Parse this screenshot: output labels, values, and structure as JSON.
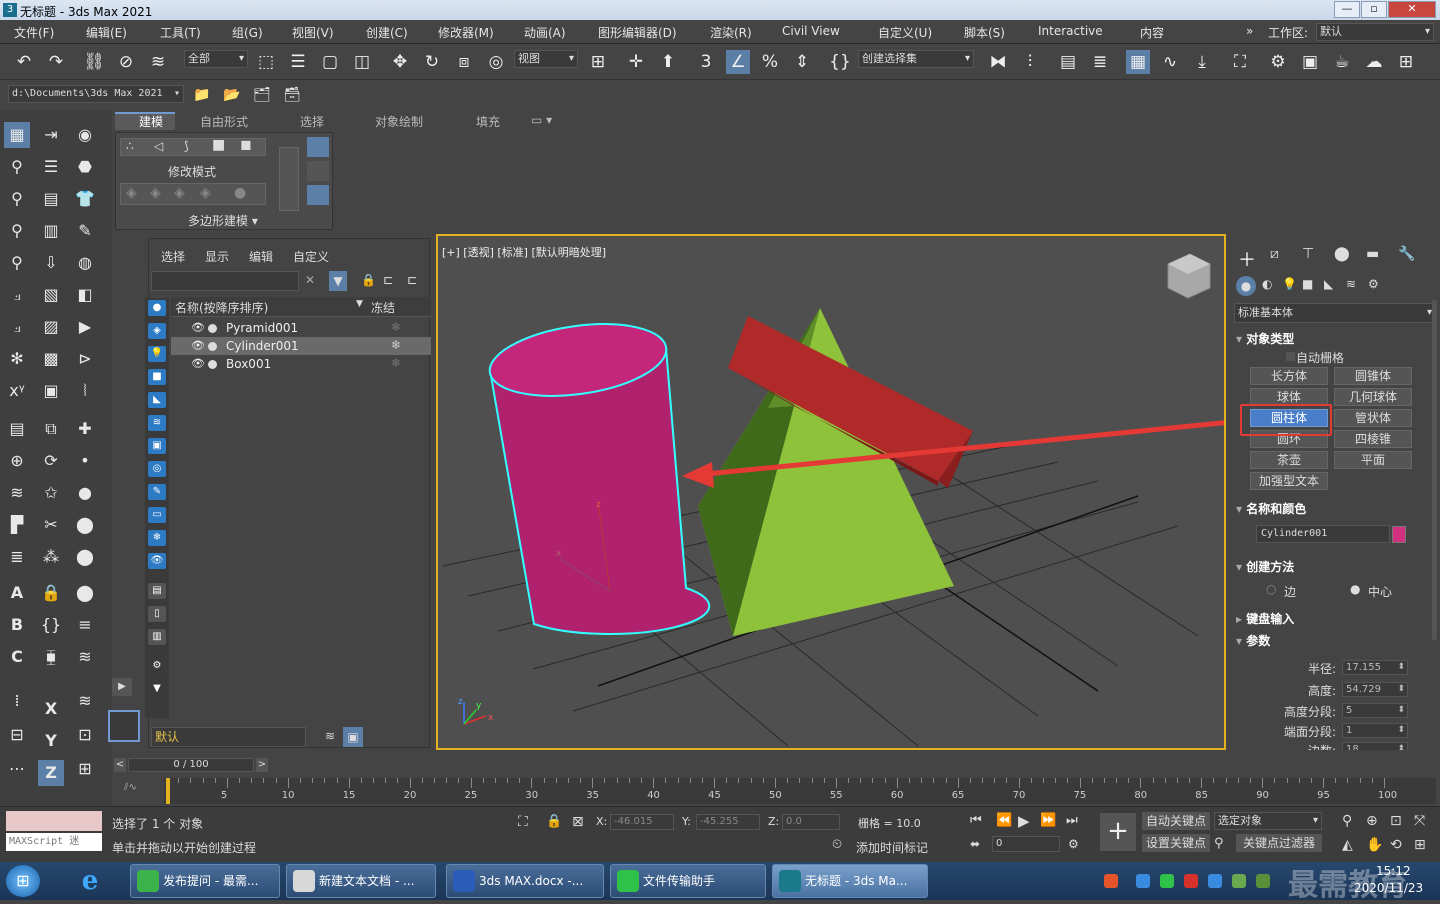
{
  "window": {
    "title": "无标题 - 3ds Max 2021",
    "logo_glyph": "3",
    "minimize": "—",
    "restore": "▫",
    "close": "✕"
  },
  "menu": [
    "文件(F)",
    "编辑(E)",
    "工具(T)",
    "组(G)",
    "视图(V)",
    "创建(C)",
    "修改器(M)",
    "动画(A)",
    "图形编辑器(D)",
    "渲染(R)",
    "Civil View",
    "自定义(U)",
    "脚本(S)",
    "Interactive",
    "内容"
  ],
  "workspace": {
    "expander": "»",
    "label": "工作区:",
    "value": "默认"
  },
  "toolbar": {
    "selection_filter": "全部",
    "ref_coord": "视图",
    "named_selection": "创建选择集"
  },
  "path": {
    "value": "d:\\Documents\\3ds Max 2021"
  },
  "ribbon": {
    "tabs": [
      "建模",
      "自由形式",
      "选择",
      "对象绘制",
      "填充"
    ],
    "modify_mode": "修改模式",
    "poly_modeling": "多边形建模 ▾",
    "tab_menu": "▭ ▾"
  },
  "scene": {
    "menus": [
      "选择",
      "显示",
      "编辑",
      "自定义"
    ],
    "search_clear": "✕",
    "col_name": "名称(按降序排序)",
    "col_freeze": "冻结",
    "rows": [
      {
        "name": "Pyramid001",
        "freeze": "❄"
      },
      {
        "name": "Cylinder001",
        "freeze": "❄"
      },
      {
        "name": "Box001",
        "freeze": "❄"
      }
    ],
    "layer": "默认"
  },
  "viewport": {
    "label": "[+] [透视] [标准] [默认明暗处理]",
    "axis_x": "x",
    "axis_y": "y",
    "axis_z": "z"
  },
  "command_panel": {
    "category": "标准基本体",
    "section_object_type": "对象类型",
    "autogrid": "自动栅格",
    "buttons": [
      "长方体",
      "圆锥体",
      "球体",
      "几何球体",
      "圆柱体",
      "管状体",
      "圆环",
      "四棱锥",
      "茶壶",
      "平面",
      "加强型文本"
    ],
    "section_name_color": "名称和颜色",
    "object_name": "Cylinder001",
    "object_color": "#d1307f",
    "section_creation": "创建方法",
    "opt_edge": "边",
    "opt_center": "中心",
    "section_keyboard": "键盘输入",
    "section_params": "参数",
    "params": [
      {
        "label": "半径:",
        "value": "17.155"
      },
      {
        "label": "高度:",
        "value": "54.729"
      },
      {
        "label": "高度分段:",
        "value": "5"
      },
      {
        "label": "端面分段:",
        "value": "1"
      },
      {
        "label": "边数:",
        "value": "18"
      }
    ]
  },
  "timeline": {
    "frame": "0 / 100",
    "ticks": [
      "5",
      "10",
      "15",
      "20",
      "25",
      "30",
      "35",
      "40",
      "45",
      "50",
      "55",
      "60",
      "65",
      "70",
      "75",
      "80",
      "85",
      "90",
      "95",
      "100"
    ],
    "prev_glyph": "<",
    "next_glyph": ">",
    "play_glyph": "▶"
  },
  "status": {
    "maxscript": "MAXScript 迷",
    "selected": "选择了 1 个 对象",
    "prompt": "单击并拖动以开始创建过程",
    "x_label": "X:",
    "x_value": "-46.015",
    "y_label": "Y:",
    "y_value": "-45.255",
    "z_label": "Z:",
    "z_value": "0.0",
    "grid": "栅格 = 10.0",
    "add_time_tag": "添加时间标记",
    "auto_key": "自动关键点",
    "set_key": "设置关键点",
    "selected_obj": "选定对象",
    "key_filter": "关键点过滤器",
    "frame_field": "0"
  },
  "taskbar": {
    "tasks": [
      "发布提问 - 最需...",
      "新建文本文档 - ...",
      "3ds MAX.docx -...",
      "文件传输助手",
      "无标题 - 3ds Ma..."
    ],
    "time": "15:12",
    "date": "2020/11/23",
    "watermark": "最需教育"
  },
  "colors": {
    "cylinder": "#c4267a",
    "pyramid": "#8fc23b",
    "box": "#b02a2a",
    "highlight": "#e53935",
    "viewport_border": "#e3b21f"
  }
}
